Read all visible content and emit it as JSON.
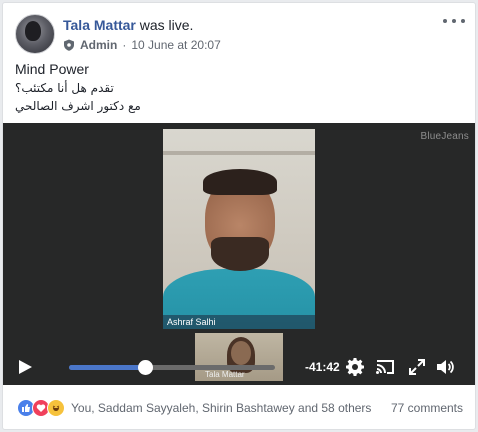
{
  "post": {
    "author": "Tala Mattar",
    "action": "was live.",
    "role": "Admin",
    "separator": "·",
    "date": "10 June at 20:07",
    "text_line1": "Mind Power",
    "text_line2": "تقدم هل أنا مكتئب؟",
    "text_line3": "مع دكتور اشرف الصالحي"
  },
  "video": {
    "watermark": "BlueJeans",
    "main_participant": "Ashraf Salhi",
    "thumb_participant": "Tala Mattar",
    "time_remaining": "-41:42",
    "progress_fraction": 0.37
  },
  "footer": {
    "reactors": "You, Saddam Sayyaleh, Shirin Bashtawey and 58 others",
    "comments": "77 comments"
  },
  "colors": {
    "link": "#365899",
    "progress_fill": "#4a76c9",
    "like": "#4a80ea",
    "love": "#f0405b",
    "haha": "#f6c23c"
  },
  "icons": [
    "shield-icon",
    "more-options-icon",
    "play-icon",
    "settings-icon",
    "cast-icon",
    "fullscreen-icon",
    "volume-icon",
    "like-reaction-icon",
    "love-reaction-icon",
    "haha-reaction-icon"
  ]
}
